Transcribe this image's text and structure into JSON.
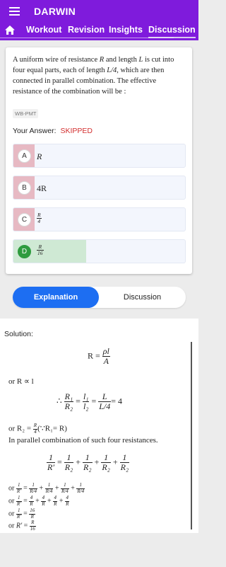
{
  "app": {
    "title": "DARWIN"
  },
  "nav": {
    "tabs": [
      "Workout",
      "Revision",
      "Insights",
      "Discussion"
    ],
    "active": "Discussion"
  },
  "question": {
    "text_parts": [
      "A uniform wire of resistance ",
      "R",
      " and length ",
      "L",
      " is cut into four equal parts, each of length ",
      "L/4",
      ", which are then connected in parallel combination. The effective resistance of the combination will be :"
    ],
    "source": "WB-PMT",
    "answer_label": "Your Answer:",
    "answer_status": "SKIPPED"
  },
  "options": [
    {
      "letter": "A",
      "text": "R",
      "state": "wrong"
    },
    {
      "letter": "B",
      "text": "4R",
      "state": "neutral"
    },
    {
      "letter": "C",
      "num": "R",
      "den": "4",
      "state": "wrong"
    },
    {
      "letter": "D",
      "num": "R",
      "den": "16",
      "state": "correct"
    }
  ],
  "colors": {
    "brand": "#7f1bdc",
    "accent": "#1d6ef2",
    "wrong_fill": "#e7b9c3",
    "correct_fill": "#cfe9d4",
    "skipped": "#d32f2f"
  },
  "tabs": {
    "explanation": "Explanation",
    "discussion": "Discussion"
  },
  "solution": {
    "label": "Solution:",
    "eq1_lhs": "R =",
    "eq1_num": "ρl",
    "eq1_den": "A",
    "or_prop": "or R ∝ l",
    "therefore": "∴",
    "eq2_eq": "=",
    "eq2_r_num": "R₁",
    "eq2_r_den": "R₂",
    "eq2_l_num": "l₁",
    "eq2_l_den": "l₂",
    "eq2_L_num": "L",
    "eq2_L_den": "L/4",
    "eq2_rhs": "= 4",
    "r2_prefix": "or R₂ =",
    "r2_num": "R",
    "r2_den": "4",
    "r2_suffix": "(∵R₁= R)",
    "parallel_text": "In parallel combination of such four resistances.",
    "par_plus": "+",
    "par_lhs_num": "1",
    "par_lhs_den": "R′",
    "par_num": "1",
    "par_den": "R₂",
    "or": "or",
    "l1_lhs_den": "R′",
    "l1_den": "R/4",
    "l2_num": "4",
    "l2_den": "R",
    "l3_num": "16",
    "l3_den": "R",
    "l4_lhs": "R′",
    "l4_num": "R",
    "l4_den": "16",
    "one": "1",
    "eq": "="
  }
}
